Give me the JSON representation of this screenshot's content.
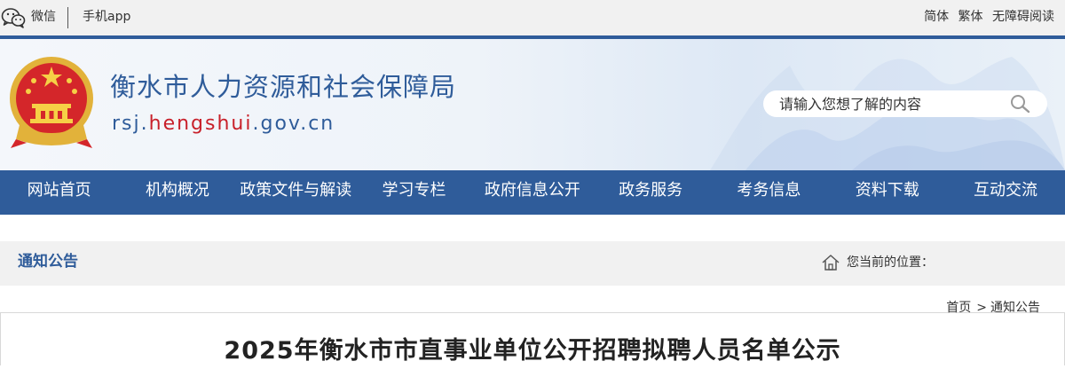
{
  "topbar": {
    "wechat_label": "微信",
    "app_label": "手机app",
    "lang": {
      "simplified": "简体",
      "traditional": "繁体",
      "accessibility": "无障碍阅读"
    }
  },
  "header": {
    "title": "衡水市人力资源和社会保障局",
    "domain_prefix": "rsj.",
    "domain_highlight": "hengshui",
    "domain_suffix": ".gov.cn"
  },
  "search": {
    "placeholder": "请输入您想了解的内容"
  },
  "nav": {
    "items": [
      "网站首页",
      "机构概况",
      "政策文件与解读",
      "学习专栏",
      "政府信息公开",
      "政务服务",
      "考务信息",
      "资料下载",
      "互动交流"
    ]
  },
  "section": {
    "title": "通知公告",
    "location_label": "您当前的位置："
  },
  "breadcrumb": {
    "home": "首页",
    "arrow": ">",
    "current": "通知公告"
  },
  "article": {
    "title": "2025年衡水市市直事业单位公开招聘拟聘人员名单公示"
  },
  "colors": {
    "brand_blue": "#2f5c9a",
    "brand_red": "#c8202a",
    "topbar_bg": "#f1f1f1"
  }
}
